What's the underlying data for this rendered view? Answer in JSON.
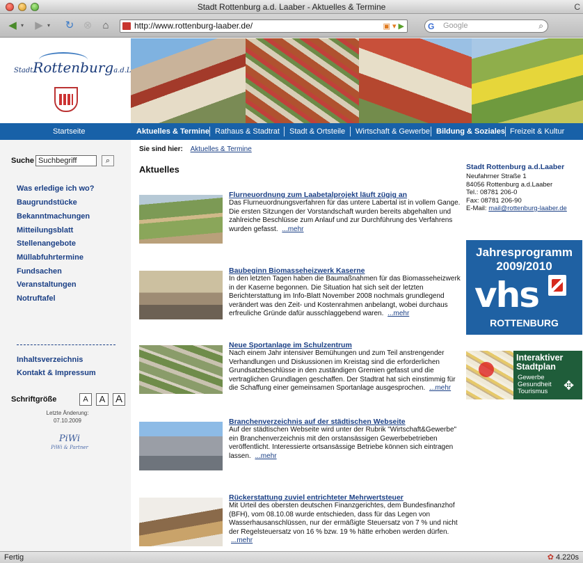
{
  "window": {
    "title": "Stadt Rottenburg a.d. Laaber - Aktuelles & Termine",
    "title_right": "C"
  },
  "browser": {
    "url": "http://www.rottenburg-laaber.de/",
    "search_placeholder": "Google",
    "status_left": "Fertig",
    "status_right": "4.220s"
  },
  "logo": {
    "prefix": "Stadt",
    "name": "Rottenburg",
    "suffix": "a.d.Laaber"
  },
  "nav": {
    "items": [
      {
        "label": "Startseite"
      },
      {
        "label": "Aktuelles & Termine"
      },
      {
        "label": "Rathaus & Stadtrat"
      },
      {
        "label": "Stadt & Ortsteile"
      },
      {
        "label": "Wirtschaft & Gewerbe"
      },
      {
        "label": "Bildung & Soziales"
      },
      {
        "label": "Freizeit & Kultur"
      }
    ]
  },
  "sidebar": {
    "search_label": "Suche",
    "search_value": "Suchbegriff",
    "links": [
      {
        "label": "Was erledige ich wo?"
      },
      {
        "label": "Baugrundstücke"
      },
      {
        "label": "Bekanntmachungen"
      },
      {
        "label": "Mitteilungsblatt"
      },
      {
        "label": "Stellenangebote"
      },
      {
        "label": "Müllabfuhrtermine"
      },
      {
        "label": "Fundsachen"
      },
      {
        "label": "Veranstaltungen"
      },
      {
        "label": "Notruftafel"
      },
      {
        "label": "Inhaltsverzeichnis"
      },
      {
        "label": "Kontakt & Impressum"
      }
    ],
    "font_size_label": "Schriftgröße",
    "font_buttons": [
      "A",
      "A",
      "A"
    ],
    "last_change_label": "Letzte Änderung:",
    "last_change_date": "07.10.2009",
    "partner_logo": "PiWi",
    "partner_sub": "PiWi & Partner"
  },
  "main": {
    "breadcrumb_label": "Sie sind hier:",
    "breadcrumb_link": "Aktuelles & Termine",
    "section_title": "Aktuelles",
    "more_label": "...mehr",
    "articles": [
      {
        "title": "Flurneuordnung zum Laabetalprojekt läuft zügig an",
        "text": "Das Flurneuordnungsverfahren für das untere Labertal ist in vollem Gange. Die ersten Sitzungen der Vorstandschaft wurden bereits abgehalten und zahlreiche Beschlüsse zum Anlauf und zur Durchführung des Verfahrens wurden gefasst."
      },
      {
        "title": "Baubeginn Biomasseheizwerk Kaserne",
        "text": "In den letzten Tagen haben die Baumaßnahmen für das Biomasseheizwerk in der Kaserne begonnen. Die Situation hat sich seit der letzten Berichterstattung im Info-Blatt November 2008 nochmals grundlegend verändert was den Zeit- und Kostenrahmen anbelangt, wobei durchaus erfreuliche Gründe dafür ausschlaggebend waren."
      },
      {
        "title": "Neue Sportanlage im Schulzentrum",
        "text": "Nach einem Jahr intensiver Bemühungen und zum Teil anstrengender Verhandlungen und Diskussionen im Kreistag sind die erforderlichen Grundsatzbeschlüsse in den zuständigen Gremien gefasst und die vertraglichen Grundlagen geschaffen. Der Stadtrat hat sich einstimmig für die Schaffung einer gemeinsamen Sportanlage ausgesprochen."
      },
      {
        "title": "Branchenverzeichnis auf der städtischen Webseite",
        "text": "Auf der städtischen Webseite wird unter der Rubrik \"Wirtschaft&Gewerbe\" ein Branchenverzeichnis mit den orstansässigen Gewerbebetrieben veröffentlicht. Interessierte ortsansässige Betriebe können sich eintragen lassen."
      },
      {
        "title": "Rückerstattung zuviel entrichteter Mehrwertsteuer",
        "text": "Mit Urteil des obersten deutschen Finanzgerichtes, dem Bundesfinanzhof (BFH), vom 08.10.08 wurde entschieden, dass für das Legen von Wasserhausanschlüssen, nur der ermäßigte Steuersatz von 7 % und nicht der Regelsteuersatz von 16 % bzw. 19 % hätte erhoben werden dürfen."
      }
    ]
  },
  "right": {
    "address_title": "Stadt Rottenburg a.d.Laaber",
    "street": "Neufahrner Straße 1",
    "city": "84056 Rottenburg a.d.Laaber",
    "tel": "Tel.: 08781 206-0",
    "fax": "Fax: 08781 206-90",
    "email_label": "E-Mail:",
    "email": "mail@rottenburg-laaber.de",
    "vhs_title_1": "Jahresprogramm",
    "vhs_title_2": "2009/2010",
    "vhs_big": "vhs",
    "vhs_sub": "ROTTENBURG",
    "stadtplan_title_1": "Interaktiver",
    "stadtplan_title_2": "Stadtplan",
    "stadtplan_sub_1": "Gewerbe",
    "stadtplan_sub_2": "Gesundheit",
    "stadtplan_sub_3": "Tourismus"
  },
  "colors": {
    "nav_blue": "#1861a8",
    "link_blue": "#1a3f85",
    "vhs_blue": "#1f61a3",
    "stadtplan_green": "#1f5d3a"
  }
}
